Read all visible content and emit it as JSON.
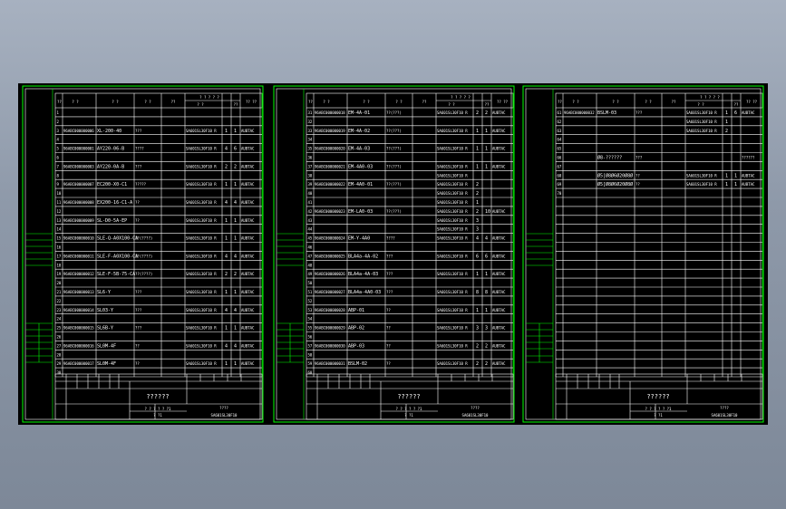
{
  "colors": {
    "frame": "#00ff00",
    "text": "#ffffff",
    "background": "#000000"
  },
  "sheets": [
    {
      "header": {
        "c0": "??",
        "c1": "? ?",
        "c2": "? ?",
        "c3": "? ?",
        "c4": "??",
        "c5": "? ? ? ? ?",
        "c5a": "? ?",
        "c5b": "??",
        "c6": "?? ??"
      },
      "rows": [
        {
          "n": "1",
          "code": "",
          "name": "",
          "mat": "",
          "std": "",
          "q": "",
          "w": "",
          "note": ""
        },
        {
          "n": "2",
          "code": "",
          "name": "",
          "mat": "",
          "std": "",
          "q": "",
          "w": "",
          "note": ""
        },
        {
          "n": "3",
          "code": "96ABC000000006",
          "name": "XL-200-40",
          "mat": "???",
          "std": "SA601SL30F10 R",
          "q": "1",
          "w": "1",
          "note": "AUBTAC"
        },
        {
          "n": "4",
          "code": "",
          "name": "",
          "mat": "",
          "std": "",
          "q": "",
          "w": "",
          "note": ""
        },
        {
          "n": "5",
          "code": "96ABC000000001",
          "name": "AY220-06-B",
          "mat": "????",
          "std": "SA601SL30F10 R",
          "q": "4",
          "w": "6",
          "note": "AUBTAC"
        },
        {
          "n": "6",
          "code": "",
          "name": "",
          "mat": "",
          "std": "",
          "q": "",
          "w": "",
          "note": ""
        },
        {
          "n": "7",
          "code": "96ABC000000003",
          "name": "AY220-0A-B",
          "mat": "???",
          "std": "SA601SL30F10 R",
          "q": "2",
          "w": "2",
          "note": "AUBTAC"
        },
        {
          "n": "8",
          "code": "",
          "name": "",
          "mat": "",
          "std": "",
          "q": "",
          "w": "",
          "note": ""
        },
        {
          "n": "9",
          "code": "96ABC000000007",
          "name": "EC200-X0-C1",
          "mat": "?????",
          "std": "SA601SL30F10 R",
          "q": "1",
          "w": "1",
          "note": "AUBTAC"
        },
        {
          "n": "10",
          "code": "",
          "name": "",
          "mat": "",
          "std": "",
          "q": "",
          "w": "",
          "note": ""
        },
        {
          "n": "11",
          "code": "96ABC000000008",
          "name": "EX200-16-C1-A",
          "mat": "??",
          "std": "SA601SL30F10 R",
          "q": "4",
          "w": "4",
          "note": "AUBTAC"
        },
        {
          "n": "12",
          "code": "",
          "name": "",
          "mat": "",
          "std": "",
          "q": "",
          "w": "",
          "note": ""
        },
        {
          "n": "13",
          "code": "96ABC000000009",
          "name": "SL-D0-5A-EP",
          "mat": "??",
          "std": "SA601SL30F10 R",
          "q": "1",
          "w": "1",
          "note": "AUBTAC"
        },
        {
          "n": "14",
          "code": "",
          "name": "",
          "mat": "",
          "std": "",
          "q": "",
          "w": "",
          "note": ""
        },
        {
          "n": "15",
          "code": "96ABC000000010",
          "name": "SLE-Q-A0X100-CA",
          "mat": "??(????)",
          "std": "SA601SL30F10 R",
          "q": "1",
          "w": "1",
          "note": "AUBTAC"
        },
        {
          "n": "16",
          "code": "",
          "name": "",
          "mat": "",
          "std": "",
          "q": "",
          "w": "",
          "note": ""
        },
        {
          "n": "17",
          "code": "96ABC000000011",
          "name": "SLE-F-A0X100-CA",
          "mat": "??(????)",
          "std": "SA601SL30F10 R",
          "q": "4",
          "w": "4",
          "note": "AUBTAC"
        },
        {
          "n": "18",
          "code": "",
          "name": "",
          "mat": "",
          "std": "",
          "q": "",
          "w": "",
          "note": ""
        },
        {
          "n": "19",
          "code": "96ABC000000012",
          "name": "SLE-F-5B-75-CA",
          "mat": "??(????)",
          "std": "SA601SL30F10 R",
          "q": "2",
          "w": "2",
          "note": "AUBTAC"
        },
        {
          "n": "20",
          "code": "",
          "name": "",
          "mat": "",
          "std": "",
          "q": "",
          "w": "",
          "note": ""
        },
        {
          "n": "21",
          "code": "96ABC000000013",
          "name": "SL6-Y",
          "mat": "???",
          "std": "SA601SL30F10 R",
          "q": "1",
          "w": "1",
          "note": "AUBTAC"
        },
        {
          "n": "22",
          "code": "",
          "name": "",
          "mat": "",
          "std": "",
          "q": "",
          "w": "",
          "note": ""
        },
        {
          "n": "23",
          "code": "96ABC000000014",
          "name": "SL03-Y",
          "mat": "???",
          "std": "SA601SL30F10 R",
          "q": "4",
          "w": "4",
          "note": "AUBTAC"
        },
        {
          "n": "24",
          "code": "",
          "name": "",
          "mat": "",
          "std": "",
          "q": "",
          "w": "",
          "note": ""
        },
        {
          "n": "25",
          "code": "96ABC000000015",
          "name": "SL6B-Y",
          "mat": "???",
          "std": "SA601SL30F10 R",
          "q": "1",
          "w": "1",
          "note": "AUBTAC"
        },
        {
          "n": "26",
          "code": "",
          "name": "",
          "mat": "",
          "std": "",
          "q": "",
          "w": "",
          "note": ""
        },
        {
          "n": "27",
          "code": "96ABC000000016",
          "name": "SL0M-4F",
          "mat": "??",
          "std": "SA601SL30F10 R",
          "q": "4",
          "w": "4",
          "note": "AUBTAC"
        },
        {
          "n": "28",
          "code": "",
          "name": "",
          "mat": "",
          "std": "",
          "q": "",
          "w": "",
          "note": ""
        },
        {
          "n": "29",
          "code": "96ABC000000017",
          "name": "SL0M-4F",
          "mat": "??",
          "std": "SA601SL30F10 R",
          "q": "1",
          "w": "1",
          "note": "AUBTAC"
        },
        {
          "n": "30",
          "code": "",
          "name": "",
          "mat": "",
          "std": "",
          "q": "",
          "w": "",
          "note": ""
        }
      ],
      "title_block": {
        "project": "??????",
        "sheet": "????",
        "sheet_no": "? ? ? ?     ? ?1",
        "drawing_no": "SA601SL30F10",
        "rev": "? ?1"
      }
    },
    {
      "header": {
        "c0": "??",
        "c1": "? ?",
        "c2": "? ?",
        "c3": "? ?",
        "c4": "??",
        "c5": "? ? ? ? ?",
        "c5a": "? ?",
        "c5b": "??",
        "c6": "?? ??"
      },
      "rows": [
        {
          "n": "31",
          "code": "96ABC000000018",
          "name": "EM-4A-01",
          "mat": "??(???)",
          "std": "SA601SL30F10 R",
          "q": "2",
          "w": "2",
          "note": "AUBTAC"
        },
        {
          "n": "32",
          "code": "",
          "name": "",
          "mat": "",
          "std": "",
          "q": "",
          "w": "",
          "note": ""
        },
        {
          "n": "33",
          "code": "96ABC000000019",
          "name": "EM-4A-02",
          "mat": "??(???)",
          "std": "SA601SL30F10 R",
          "q": "1",
          "w": "1",
          "note": "AUBTAC"
        },
        {
          "n": "34",
          "code": "",
          "name": "",
          "mat": "",
          "std": "",
          "q": "",
          "w": "",
          "note": ""
        },
        {
          "n": "35",
          "code": "96ABC000000020",
          "name": "EM-4A-03",
          "mat": "??(???)",
          "std": "SA601SL30F10 R",
          "q": "1",
          "w": "1",
          "note": "AUBTAC"
        },
        {
          "n": "36",
          "code": "",
          "name": "",
          "mat": "",
          "std": "",
          "q": "",
          "w": "",
          "note": ""
        },
        {
          "n": "37",
          "code": "96ABC000000021",
          "name": "EM-4A0-03",
          "mat": "??(???)",
          "std": "SA601SL30F10 R",
          "q": "1",
          "w": "1",
          "note": "AUBTAC"
        },
        {
          "n": "38",
          "code": "",
          "name": "",
          "mat": "",
          "std": "SA601SL30F10 R",
          "q": "",
          "w": "",
          "note": ""
        },
        {
          "n": "39",
          "code": "96ABC000000022",
          "name": "EM-4A0-01",
          "mat": "??(???)",
          "std": "SA601SL30F10 R",
          "q": "2",
          "w": "",
          "note": ""
        },
        {
          "n": "40",
          "code": "",
          "name": "",
          "mat": "",
          "std": "SA601SL30F10 R",
          "q": "2",
          "w": "",
          "note": ""
        },
        {
          "n": "41",
          "code": "",
          "name": "",
          "mat": "",
          "std": "SA601SL30F10 R",
          "q": "1",
          "w": "",
          "note": ""
        },
        {
          "n": "42",
          "code": "96ABC000000023",
          "name": "EM-LA0-03",
          "mat": "??(???)",
          "std": "SA601SL30F10 R",
          "q": "2",
          "w": "10",
          "note": "AUBTAC"
        },
        {
          "n": "43",
          "code": "",
          "name": "",
          "mat": "",
          "std": "SA601SL30F10 R",
          "q": "3",
          "w": "",
          "note": ""
        },
        {
          "n": "44",
          "code": "",
          "name": "",
          "mat": "",
          "std": "SA601SL30F10 R",
          "q": "3",
          "w": "",
          "note": ""
        },
        {
          "n": "45",
          "code": "96ABC000000024",
          "name": "EM-Y-4A0",
          "mat": "????",
          "std": "SA601SL30F10 R",
          "q": "4",
          "w": "4",
          "note": "AUBTAC"
        },
        {
          "n": "46",
          "code": "",
          "name": "",
          "mat": "",
          "std": "",
          "q": "",
          "w": "",
          "note": ""
        },
        {
          "n": "47",
          "code": "96ABC000000025",
          "name": "BLA4a-4A-02",
          "mat": "???",
          "std": "SA601SL30F10 R",
          "q": "6",
          "w": "6",
          "note": "AUBTAC"
        },
        {
          "n": "48",
          "code": "",
          "name": "",
          "mat": "",
          "std": "",
          "q": "",
          "w": "",
          "note": ""
        },
        {
          "n": "49",
          "code": "96ABC000000026",
          "name": "BLA4a-4A-03",
          "mat": "???",
          "std": "SA601SL30F10 R",
          "q": "1",
          "w": "1",
          "note": "AUBTAC"
        },
        {
          "n": "50",
          "code": "",
          "name": "",
          "mat": "",
          "std": "",
          "q": "",
          "w": "",
          "note": ""
        },
        {
          "n": "51",
          "code": "96ABC000000027",
          "name": "BLA4a-4A0-03",
          "mat": "???",
          "std": "SA601SL30F10 R",
          "q": "8",
          "w": "8",
          "note": "AUBTAC"
        },
        {
          "n": "52",
          "code": "",
          "name": "",
          "mat": "",
          "std": "",
          "q": "",
          "w": "",
          "note": ""
        },
        {
          "n": "53",
          "code": "96ABC000000028",
          "name": "ABP-01",
          "mat": "??",
          "std": "SA601SL30F10 R",
          "q": "1",
          "w": "1",
          "note": "AUBTAC"
        },
        {
          "n": "54",
          "code": "",
          "name": "",
          "mat": "",
          "std": "",
          "q": "",
          "w": "",
          "note": ""
        },
        {
          "n": "55",
          "code": "96ABC000000029",
          "name": "ABP-02",
          "mat": "??",
          "std": "SA601SL30F10 R",
          "q": "3",
          "w": "3",
          "note": "AUBTAC"
        },
        {
          "n": "56",
          "code": "",
          "name": "",
          "mat": "",
          "std": "",
          "q": "",
          "w": "",
          "note": ""
        },
        {
          "n": "57",
          "code": "96ABC000000030",
          "name": "ABP-03",
          "mat": "??",
          "std": "SA601SL30F10 R",
          "q": "2",
          "w": "2",
          "note": "AUBTAC"
        },
        {
          "n": "58",
          "code": "",
          "name": "",
          "mat": "",
          "std": "",
          "q": "",
          "w": "",
          "note": ""
        },
        {
          "n": "59",
          "code": "96ABC000000031",
          "name": "BSLM-02",
          "mat": "??",
          "std": "SA601SL30F10 R",
          "q": "2",
          "w": "2",
          "note": "AUBTAC"
        },
        {
          "n": "60",
          "code": "",
          "name": "",
          "mat": "",
          "std": "",
          "q": "",
          "w": "",
          "note": ""
        }
      ],
      "title_block": {
        "project": "??????",
        "sheet": "????",
        "sheet_no": "? ? ? ?     ? ?1",
        "drawing_no": "SA601SL30F10",
        "rev": "? ?1"
      }
    },
    {
      "header": {
        "c0": "??",
        "c1": "? ?",
        "c2": "? ?",
        "c3": "? ?",
        "c4": "??",
        "c5": "? ? ? ? ?",
        "c5a": "? ?",
        "c5b": "??",
        "c6": "?? ??"
      },
      "rows": [
        {
          "n": "61",
          "code": "96ABC000000032",
          "name": "BSLM-03",
          "mat": "???",
          "std": "SA601SL30F10 R",
          "q": "1",
          "w": "6",
          "note": "AUBTAC"
        },
        {
          "n": "62",
          "code": "",
          "name": "",
          "mat": "",
          "std": "SA601SL30F10 R",
          "q": "1",
          "w": "",
          "note": ""
        },
        {
          "n": "63",
          "code": "",
          "name": "",
          "mat": "",
          "std": "SA601SL30F10 R",
          "q": "2",
          "w": "",
          "note": ""
        },
        {
          "n": "64",
          "code": "",
          "name": "",
          "mat": "",
          "std": "",
          "q": "",
          "w": "",
          "note": ""
        },
        {
          "n": "65",
          "code": "",
          "name": "",
          "mat": "",
          "std": "",
          "q": "",
          "w": "",
          "note": ""
        },
        {
          "n": "66",
          "code": "",
          "name": "Ø8-??????",
          "mat": "???",
          "std": "",
          "q": "",
          "w": "",
          "note": "??????"
        },
        {
          "n": "67",
          "code": "",
          "name": "",
          "mat": "",
          "std": "",
          "q": "",
          "w": "",
          "note": ""
        },
        {
          "n": "68",
          "code": "",
          "name": "Ø5[Ø8Ø6Ø20Ø8Ø",
          "mat": "??",
          "std": "SA601SL30F10 R",
          "q": "1",
          "w": "1",
          "note": "AUBTAC"
        },
        {
          "n": "69",
          "code": "",
          "name": "Ø5[Ø8Ø6Ø20Ø8Ø",
          "mat": "??",
          "std": "SA601SL30F10 R",
          "q": "1",
          "w": "1",
          "note": "AUBTAC"
        },
        {
          "n": "70",
          "code": "",
          "name": "",
          "mat": "",
          "std": "",
          "q": "",
          "w": "",
          "note": ""
        }
      ],
      "title_block": {
        "project": "??????",
        "sheet": "????",
        "sheet_no": "? ? ? ?     ? ?1",
        "drawing_no": "SA601SL30F10",
        "rev": "? ?1"
      }
    }
  ]
}
